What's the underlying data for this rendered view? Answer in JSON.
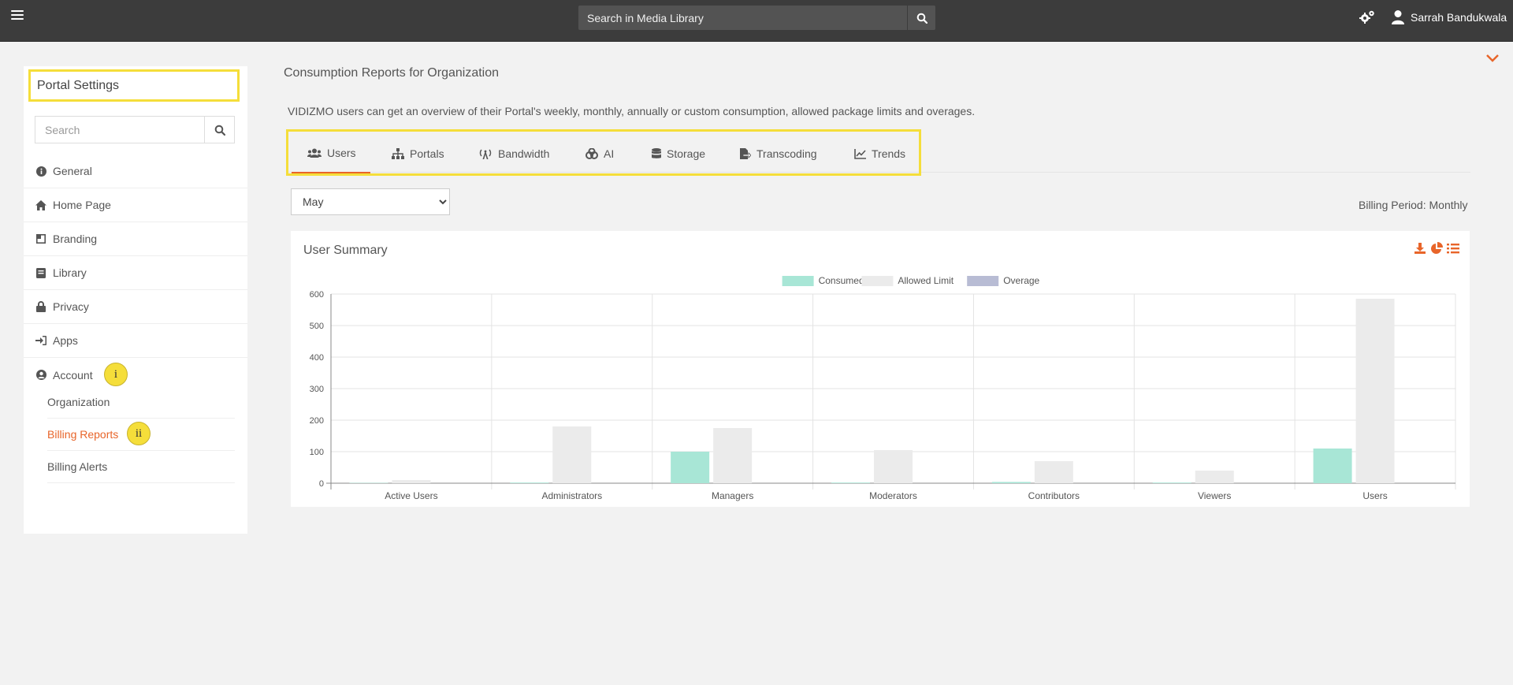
{
  "header": {
    "search_placeholder": "Search in Media Library",
    "user_name": "Sarrah Bandukwala"
  },
  "sidebar": {
    "title": "Portal Settings",
    "search_placeholder": "Search",
    "items": [
      {
        "label": "General",
        "icon": "info-icon"
      },
      {
        "label": "Home Page",
        "icon": "home-icon"
      },
      {
        "label": "Branding",
        "icon": "branding-icon"
      },
      {
        "label": "Library",
        "icon": "book-icon"
      },
      {
        "label": "Privacy",
        "icon": "lock-icon"
      },
      {
        "label": "Apps",
        "icon": "sign-in-icon"
      },
      {
        "label": "Account",
        "icon": "user-circle-icon"
      }
    ],
    "subitems": [
      {
        "label": "Organization"
      },
      {
        "label": "Billing Reports"
      },
      {
        "label": "Billing Alerts"
      }
    ],
    "markers": {
      "account": "i",
      "billing": "ii"
    }
  },
  "main": {
    "title": "Consumption Reports for Organization",
    "description": "VIDIZMO users can get an overview of their Portal's weekly, monthly, annually or custom consumption, allowed package limits and overages.",
    "tabs": [
      {
        "label": "Users",
        "icon": "users-icon"
      },
      {
        "label": "Portals",
        "icon": "sitemap-icon"
      },
      {
        "label": "Bandwidth",
        "icon": "antenna-icon"
      },
      {
        "label": "AI",
        "icon": "ai-icon"
      },
      {
        "label": "Storage",
        "icon": "database-icon"
      },
      {
        "label": "Transcoding",
        "icon": "file-export-icon"
      },
      {
        "label": "Trends",
        "icon": "line-chart-icon"
      }
    ],
    "active_tab": "Users",
    "month_selected": "May",
    "billing_period": "Billing Period: Monthly",
    "accent_color": "#e8652a",
    "highlight_color": "#f5de3a"
  },
  "chart_data": {
    "type": "bar",
    "title": "User Summary",
    "categories": [
      "Active Users",
      "Administrators",
      "Managers",
      "Moderators",
      "Contributors",
      "Viewers",
      "Users"
    ],
    "series": [
      {
        "name": "Consumed",
        "color": "#a8e6d6",
        "values": [
          1,
          2,
          100,
          2,
          4,
          2,
          110
        ]
      },
      {
        "name": "Allowed Limit",
        "color": "#ebebeb",
        "values": [
          10,
          180,
          175,
          105,
          70,
          40,
          585
        ]
      },
      {
        "name": "Overage",
        "color": "#b8bcd4",
        "values": [
          0,
          0,
          0,
          0,
          0,
          0,
          0
        ]
      }
    ],
    "ylim": [
      0,
      600
    ],
    "yticks": [
      0,
      100,
      200,
      300,
      400,
      500,
      600
    ],
    "legend": "top-center",
    "grid": true
  }
}
